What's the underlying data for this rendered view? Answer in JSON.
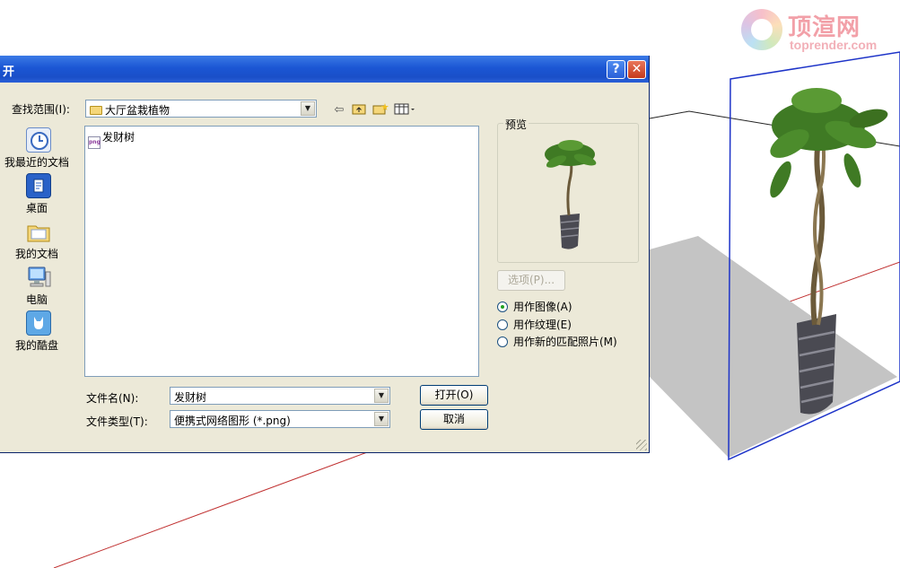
{
  "watermark": {
    "cn": "顶渲网",
    "en": "toprender.com"
  },
  "dialog": {
    "title": "开",
    "help_label": "?",
    "close_label": "✕",
    "lookin_label": "查找范围(I):",
    "lookin_value": "大厅盆栽植物",
    "places": [
      {
        "label": "我最近的文档",
        "icon": "recent-documents-icon"
      },
      {
        "label": "桌面",
        "icon": "desktop-icon"
      },
      {
        "label": "我的文档",
        "icon": "my-documents-folder-icon"
      },
      {
        "label": "电脑",
        "icon": "computer-icon"
      },
      {
        "label": "我的酷盘",
        "icon": "cloud-drive-icon"
      }
    ],
    "files": [
      {
        "name": "发财树",
        "icon": "png-file-icon"
      }
    ],
    "preview_label": "预览",
    "options_label": "选项(P)...",
    "radios": [
      {
        "label": "用作图像(A)",
        "checked": true
      },
      {
        "label": "用作纹理(E)",
        "checked": false
      },
      {
        "label": "用作新的匹配照片(M)",
        "checked": false
      }
    ],
    "filename_label": "文件名(N):",
    "filename_value": "发财树",
    "filetype_label": "文件类型(T):",
    "filetype_value": "便携式网络图形 (*.png)",
    "open_label": "打开(O)",
    "cancel_label": "取消"
  },
  "colors": {
    "titlebar": "#1b56d4",
    "dialog_bg": "#ece9d8",
    "panel_frame": "#1d33c8",
    "ground": "#c4c4c4",
    "axis_red": "#c03030"
  }
}
